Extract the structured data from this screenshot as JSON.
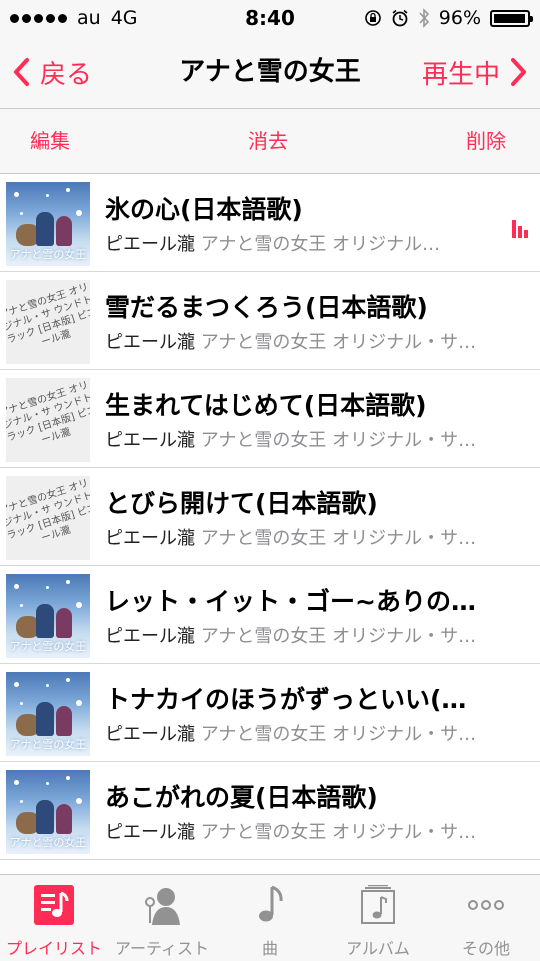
{
  "status_bar": {
    "carrier": "au",
    "network": "4G",
    "time": "8:40",
    "battery": "96%",
    "battery_level": 0.96
  },
  "nav": {
    "back_label": "戻る",
    "title": "アナと雪の女王",
    "now_playing_label": "再生中"
  },
  "toolbar": {
    "edit": "編集",
    "clear": "消去",
    "delete": "削除"
  },
  "songs": [
    {
      "title": "氷の心(日本語歌)",
      "artist": "ピエール瀧",
      "album": "アナと雪の女王 オリジナル…",
      "artwork": "frozen-cover",
      "playing": true
    },
    {
      "title": "雪だるまつくろう(日本語歌)",
      "artist": "ピエール瀧",
      "album": "アナと雪の女王 オリジナル・サ…",
      "artwork": "text-cover"
    },
    {
      "title": "生まれてはじめて(日本語歌)",
      "artist": "ピエール瀧",
      "album": "アナと雪の女王 オリジナル・サ…",
      "artwork": "text-cover"
    },
    {
      "title": "とびら開けて(日本語歌)",
      "artist": "ピエール瀧",
      "album": "アナと雪の女王 オリジナル・サ…",
      "artwork": "text-cover"
    },
    {
      "title": "レット・イット・ゴー~ありの…",
      "artist": "ピエール瀧",
      "album": "アナと雪の女王 オリジナル・サ…",
      "artwork": "frozen-cover"
    },
    {
      "title": "トナカイのほうがずっといい(…",
      "artist": "ピエール瀧",
      "album": "アナと雪の女王 オリジナル・サ…",
      "artwork": "frozen-cover"
    },
    {
      "title": "あこがれの夏(日本語歌)",
      "artist": "ピエール瀧",
      "album": "アナと雪の女王 オリジナル・サ…",
      "artwork": "frozen-cover"
    }
  ],
  "artwork_text": {
    "text_cover": "アナと雪の女王 オリジナル・サ ウンドトラック [日本版] ピエール瀧",
    "frozen_logo": "アナと雪の女王"
  },
  "tabs": [
    {
      "label": "プレイリスト",
      "icon": "playlist-icon",
      "active": true
    },
    {
      "label": "アーティスト",
      "icon": "artist-icon",
      "active": false
    },
    {
      "label": "曲",
      "icon": "music-note-icon",
      "active": false
    },
    {
      "label": "アルバム",
      "icon": "album-icon",
      "active": false
    },
    {
      "label": "その他",
      "icon": "more-icon",
      "active": false
    }
  ],
  "colors": {
    "accent": "#ff2d55",
    "inactive": "#929292",
    "bar_background": "#f7f7f7"
  }
}
